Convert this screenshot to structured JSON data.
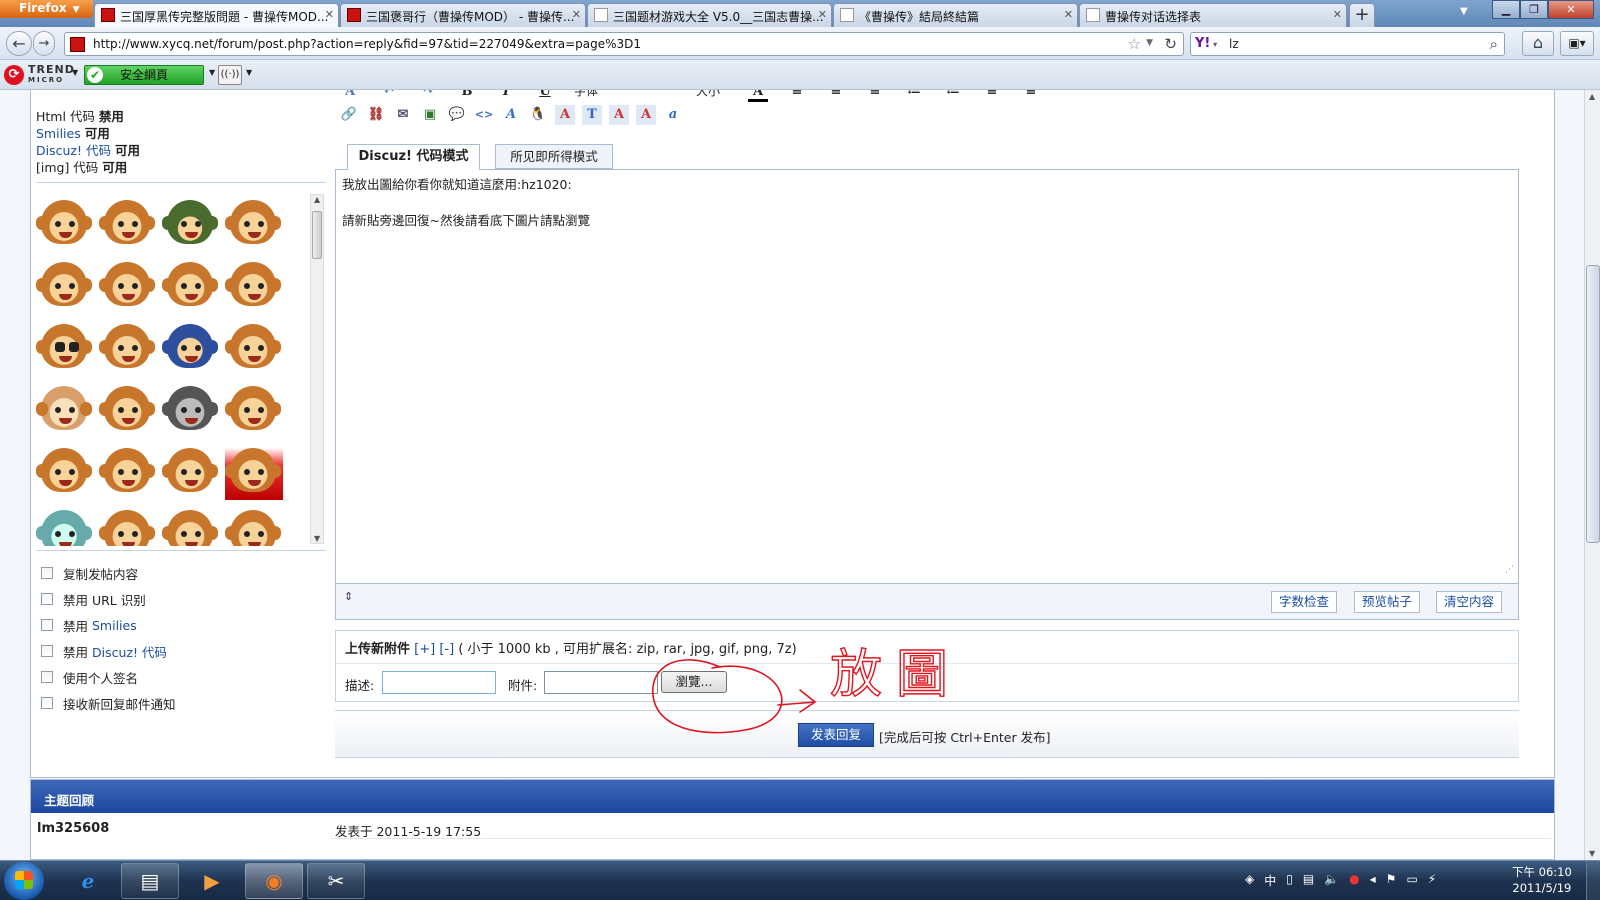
{
  "browser": {
    "menu_button": "Firefox",
    "tabs": [
      {
        "title": "三国厚黑传完整版問題 - 曹操传MOD...",
        "active": true
      },
      {
        "title": "三国褒哥行（曹操传MOD） - 曹操传...",
        "active": false
      },
      {
        "title": "三国题材游戏大全 V5.0__三国志曹操...",
        "active": false
      },
      {
        "title": "《曹操传》結局終結篇",
        "active": false
      },
      {
        "title": "曹操传对话选择表",
        "active": false
      }
    ],
    "url": "http://www.xycq.net/forum/post.php?action=reply&fid=97&tid=227049&extra=page%3D1",
    "search_engine_icon": "Y!",
    "search_value": "lz",
    "trendmicro": {
      "brand": "TREND",
      "brand_sub": "MICRO",
      "safe_label": "安全網頁"
    }
  },
  "sidebar": {
    "options": [
      {
        "label": "Html 代码",
        "status": "禁用"
      },
      {
        "label": "Smilies",
        "status": "可用"
      },
      {
        "label": "Discuz! 代码",
        "status": "可用"
      },
      {
        "label": "[img] 代码",
        "status": "可用"
      }
    ],
    "checkboxes": [
      {
        "prefix": "复制发帖内容",
        "link": ""
      },
      {
        "prefix": "禁用 URL 识别",
        "link": ""
      },
      {
        "prefix": "禁用 ",
        "link": "Smilies"
      },
      {
        "prefix": "禁用 ",
        "link": "Discuz! 代码"
      },
      {
        "prefix": "使用个人签名",
        "link": ""
      },
      {
        "prefix": "接收新回复邮件通知",
        "link": ""
      }
    ]
  },
  "editor": {
    "toolbar_top_labels": [
      "字体",
      "大小"
    ],
    "toolbar_bottom_glyphs": [
      "🔗",
      "⛓",
      "✉",
      "▣",
      "💬",
      "<>",
      "A",
      "🐧",
      "A",
      "T",
      "A",
      "A",
      "a"
    ],
    "tab_code": "Discuz! 代码模式",
    "tab_wysiwyg": "所见即所得模式",
    "content_lines": [
      "我放出圖給你看你就知道這麼用:hz1020:",
      "請新貼旁邊回復~然後請看底下圖片請點瀏覽"
    ],
    "footer_buttons": [
      "字数检查",
      "预览帖子",
      "清空内容"
    ]
  },
  "upload": {
    "title": "上传新附件",
    "add": "[+]",
    "remove": "[-]",
    "info": "( 小于 1000 kb , 可用扩展名: zip, rar, jpg, gif, png, 7z)",
    "desc_label": "描述:",
    "attach_label": "附件:",
    "browse_label": "瀏覽..."
  },
  "submit": {
    "button": "发表回复",
    "hint": "[完成后可按 Ctrl+Enter 发布]"
  },
  "annotation": {
    "text": "放圖",
    "color": "#e0141e"
  },
  "review": {
    "title": "主题回顾",
    "user": "lm325608",
    "date": "发表于 2011-5-19 17:55"
  },
  "taskbar": {
    "apps": [
      "ie",
      "explorer",
      "media",
      "firefox",
      "tools"
    ],
    "tray": [
      "中"
    ],
    "time": "下午 06:10",
    "date": "2011/5/19"
  },
  "colors": {
    "link": "#1a4ea3",
    "header_blue": "#1d48a0",
    "safe_green": "#23a228"
  }
}
